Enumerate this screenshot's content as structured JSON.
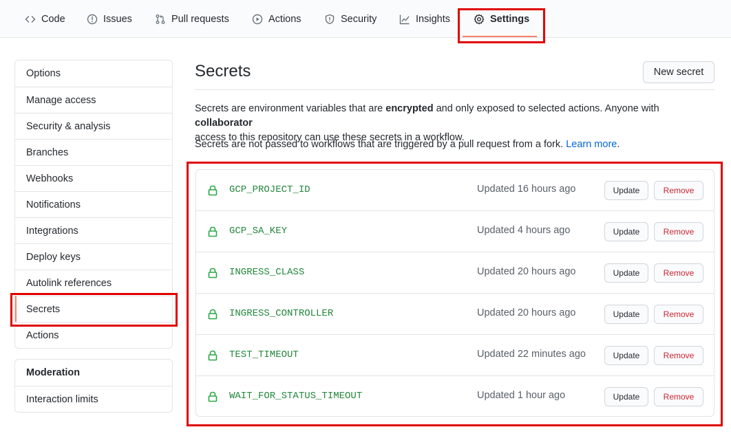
{
  "repo_nav": {
    "tabs": [
      {
        "label": "Code",
        "icon": "code-icon"
      },
      {
        "label": "Issues",
        "icon": "issue-opened-icon"
      },
      {
        "label": "Pull requests",
        "icon": "git-pull-request-icon"
      },
      {
        "label": "Actions",
        "icon": "play-icon"
      },
      {
        "label": "Security",
        "icon": "shield-icon"
      },
      {
        "label": "Insights",
        "icon": "graph-icon"
      },
      {
        "label": "Settings",
        "icon": "gear-icon",
        "active": true
      }
    ]
  },
  "sidebar": {
    "items": [
      {
        "label": "Options"
      },
      {
        "label": "Manage access"
      },
      {
        "label": "Security & analysis"
      },
      {
        "label": "Branches"
      },
      {
        "label": "Webhooks"
      },
      {
        "label": "Notifications"
      },
      {
        "label": "Integrations"
      },
      {
        "label": "Deploy keys"
      },
      {
        "label": "Autolink references"
      },
      {
        "label": "Secrets",
        "selected": true
      },
      {
        "label": "Actions"
      }
    ],
    "moderation": {
      "heading": "Moderation",
      "items": [
        {
          "label": "Interaction limits"
        }
      ]
    }
  },
  "main": {
    "title": "Secrets",
    "new_secret_label": "New secret",
    "description": {
      "p1_a": "Secrets are environment variables that are ",
      "p1_b": "encrypted",
      "p1_c": " and only exposed to selected actions. Anyone with ",
      "p1_d": "collaborator",
      "p1_e": "access to this repository can use these secrets in a workflow.",
      "p2_a": "Secrets are not passed to workflows that are triggered by a pull request from a fork. ",
      "p2_link": "Learn more",
      "p2_end": "."
    },
    "secrets": [
      {
        "name": "GCP_PROJECT_ID",
        "updated": "Updated 16 hours ago"
      },
      {
        "name": "GCP_SA_KEY",
        "updated": "Updated 4 hours ago"
      },
      {
        "name": "INGRESS_CLASS",
        "updated": "Updated 20 hours ago"
      },
      {
        "name": "INGRESS_CONTROLLER",
        "updated": "Updated 20 hours ago"
      },
      {
        "name": "TEST_TIMEOUT",
        "updated": "Updated 22 minutes ago"
      },
      {
        "name": "WAIT_FOR_STATUS_TIMEOUT",
        "updated": "Updated 1 hour ago"
      }
    ],
    "update_label": "Update",
    "remove_label": "Remove"
  },
  "colors": {
    "accent_underline": "#f9826c",
    "highlight_box": "#e00000",
    "secret_name": "#22863a",
    "lock": "#28a745",
    "remove_text": "#cb2431",
    "link": "#0366d6"
  }
}
